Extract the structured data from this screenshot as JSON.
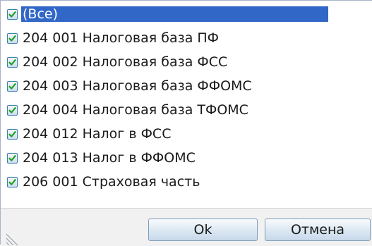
{
  "filter_list": {
    "items": [
      {
        "label": "(Все)",
        "checked": true,
        "selected": true
      },
      {
        "label": "204 001 Налоговая база ПФ",
        "checked": true
      },
      {
        "label": "204 002 Налоговая база ФСС",
        "checked": true
      },
      {
        "label": "204 003 Налоговая база ФФОМС",
        "checked": true
      },
      {
        "label": "204 004 Налоговая база ТФОМС",
        "checked": true
      },
      {
        "label": "204 012 Налог в ФСС",
        "checked": true
      },
      {
        "label": "204 013 Налог в ФФОМС",
        "checked": true
      },
      {
        "label": "206 001 Страховая часть",
        "checked": true
      }
    ]
  },
  "buttons": {
    "ok_label": "Ok",
    "cancel_label": "Отмена"
  },
  "colors": {
    "selection": "#3168c8",
    "checkbox_border": "#3c7fb1",
    "check_mark": "#21a121",
    "button_border": "#7f9db9"
  }
}
